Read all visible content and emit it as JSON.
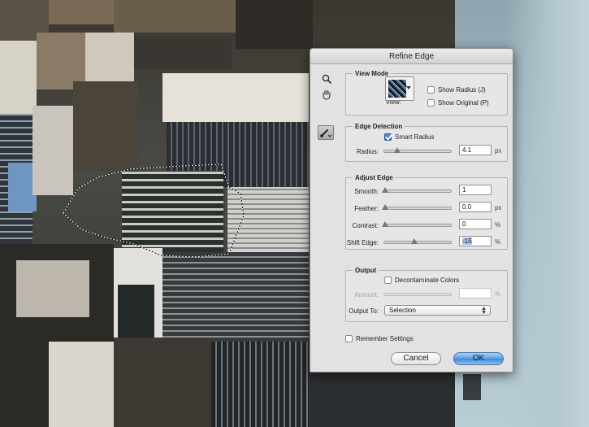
{
  "dialog": {
    "title": "Refine Edge",
    "view_mode": {
      "title": "View Mode",
      "view_label": "View:",
      "show_radius_label": "Show Radius (J)",
      "show_radius_checked": false,
      "show_original_label": "Show Original (P)",
      "show_original_checked": false
    },
    "edge_detection": {
      "title": "Edge Detection",
      "smart_radius_label": "Smart Radius",
      "smart_radius_checked": true,
      "radius_label": "Radius:",
      "radius_value": "4.1",
      "radius_unit": "px"
    },
    "adjust_edge": {
      "title": "Adjust Edge",
      "smooth_label": "Smooth:",
      "smooth_value": "1",
      "feather_label": "Feather:",
      "feather_value": "0.0",
      "feather_unit": "px",
      "contrast_label": "Contrast:",
      "contrast_value": "0",
      "contrast_unit": "%",
      "shift_edge_label": "Shift Edge:",
      "shift_edge_value": "-15",
      "shift_edge_unit": "%"
    },
    "output": {
      "title": "Output",
      "decontaminate_label": "Decontaminate Colors",
      "decontaminate_checked": false,
      "amount_label": "Amount:",
      "amount_value": "",
      "amount_unit": "%",
      "output_to_label": "Output To:",
      "output_to_value": "Selection"
    },
    "remember_label": "Remember Settings",
    "remember_checked": false,
    "cancel_label": "Cancel",
    "ok_label": "OK"
  },
  "icons": {
    "zoom": "magnifier-icon",
    "hand": "hand-icon",
    "refine_radius": "refine-radius-brush-icon"
  },
  "colors": {
    "ok_button": "#4a8fdc",
    "checkbox_checked": "#2f64b8",
    "text_highlight": "#a9c6ee"
  }
}
